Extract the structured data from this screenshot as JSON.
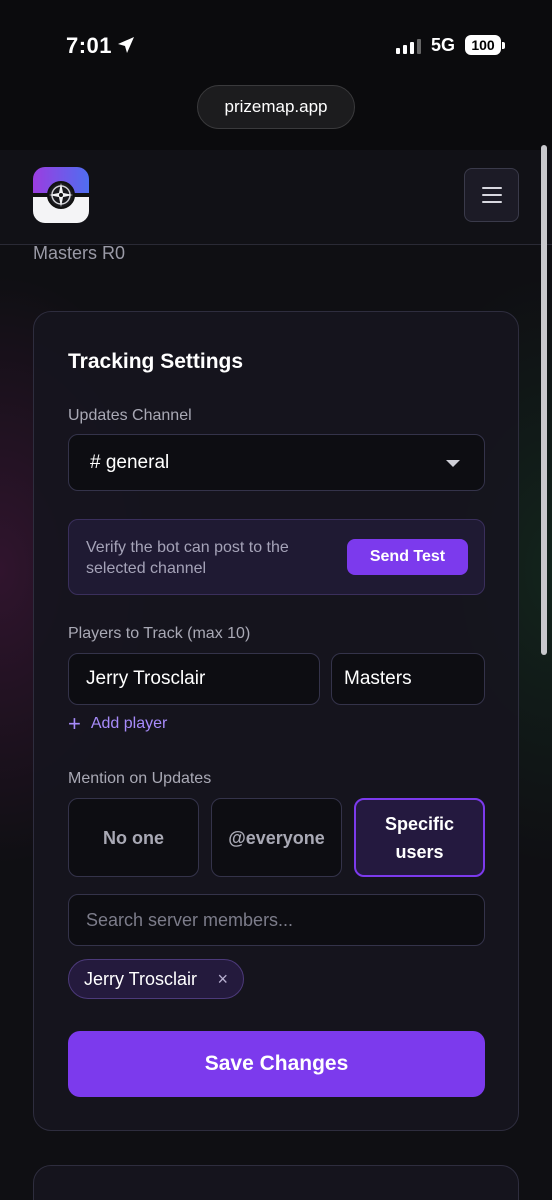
{
  "status_bar": {
    "time": "7:01",
    "network": "5G",
    "battery": "100"
  },
  "browser": {
    "url": "prizemap.app"
  },
  "nav": {
    "logo_icon": "compass-icon",
    "menu_icon": "hamburger-icon"
  },
  "breadcrumb": "Masters R0",
  "tracking": {
    "title": "Tracking Settings",
    "channel_label": "Updates Channel",
    "channel_value": "# general",
    "verify_text": "Verify the bot can post to the selected channel",
    "send_test_label": "Send Test",
    "players_label": "Players to Track (max 10)",
    "players": [
      {
        "name": "Jerry Trosclair",
        "division": "Masters"
      }
    ],
    "add_player_label": "Add player",
    "mention_label": "Mention on Updates",
    "mention_options": [
      "No one",
      "@everyone",
      "Specific users"
    ],
    "mention_selected": "Specific users",
    "search_placeholder": "Search server members...",
    "selected_users": [
      "Jerry Trosclair"
    ],
    "chip_remove": "×",
    "save_label": "Save Changes"
  },
  "colors": {
    "accent": "#7c3aed",
    "accent_light": "#a78bfa",
    "background": "#0f0f13",
    "card": "#16151e"
  }
}
